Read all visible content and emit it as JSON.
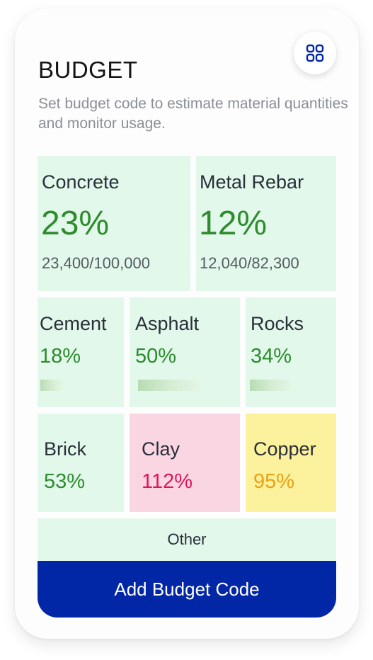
{
  "header": {
    "title": "BUDGET",
    "subtitle": "Set budget code to estimate material quantities and monitor usage.",
    "grid_icon": "grid-icon"
  },
  "materials": {
    "concrete": {
      "label": "Concrete",
      "percent": "23%",
      "count": "23,400/100,000"
    },
    "metal_rebar": {
      "label": "Metal Rebar",
      "percent": "12%",
      "count": "12,040/82,300"
    },
    "cement": {
      "label": "Cement",
      "percent": "18%",
      "progress": 0.18
    },
    "asphalt": {
      "label": "Asphalt",
      "percent": "50%",
      "progress": 0.5
    },
    "rocks": {
      "label": "Rocks",
      "percent": "34%",
      "progress": 0.34
    },
    "brick": {
      "label": "Brick",
      "percent": "53%"
    },
    "clay": {
      "label": "Clay",
      "percent": "112%"
    },
    "copper": {
      "label": "Copper",
      "percent": "95%"
    }
  },
  "other_label": "Other",
  "add_button_label": "Add Budget Code",
  "colors": {
    "tile_ok": "#e2f8ea",
    "tile_over": "#fad6e3",
    "tile_warn": "#fcf19c",
    "accent": "#0227a6",
    "percent_ok": "#2e8b2e",
    "percent_over": "#e0165a",
    "percent_warn": "#e8a214"
  }
}
